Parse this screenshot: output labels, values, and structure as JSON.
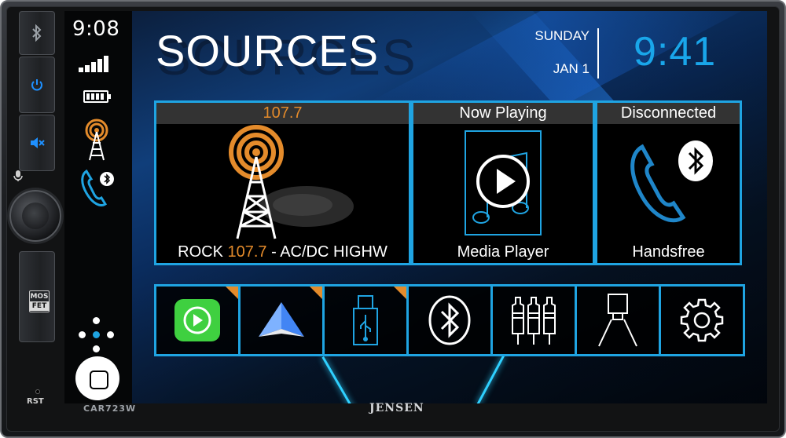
{
  "device": {
    "model": "CAR723W",
    "brand": "JENSEN",
    "rst_label": "RST",
    "mosfet": [
      "MOS",
      "FET"
    ]
  },
  "status": {
    "time": "9:08"
  },
  "header": {
    "title": "SOURCES",
    "day": "SUNDAY",
    "date": "JAN 1",
    "clock": "9:41"
  },
  "tiles": {
    "radio": {
      "header": "107.7",
      "footer_prefix": "ROCK ",
      "footer_freq": "107.7",
      "footer_suffix": " - AC/DC HIGHW"
    },
    "media": {
      "header": "Now Playing",
      "footer": "Media Player"
    },
    "phone": {
      "header": "Disconnected",
      "footer": "Handsfree"
    }
  },
  "sources": [
    {
      "name": "Apple CarPlay",
      "icon": "carplay-icon"
    },
    {
      "name": "Android Auto",
      "icon": "android-auto-icon"
    },
    {
      "name": "USB",
      "icon": "usb-icon"
    },
    {
      "name": "Bluetooth",
      "icon": "bluetooth-icon"
    },
    {
      "name": "AV In",
      "icon": "rca-icon"
    },
    {
      "name": "Camera",
      "icon": "camera-icon"
    },
    {
      "name": "Settings",
      "icon": "gear-icon"
    }
  ],
  "colors": {
    "accent_blue": "#1fa4e2",
    "clock_blue": "#19a6ea",
    "radio_orange": "#e48b2b",
    "carplay_green": "#3fd040"
  }
}
